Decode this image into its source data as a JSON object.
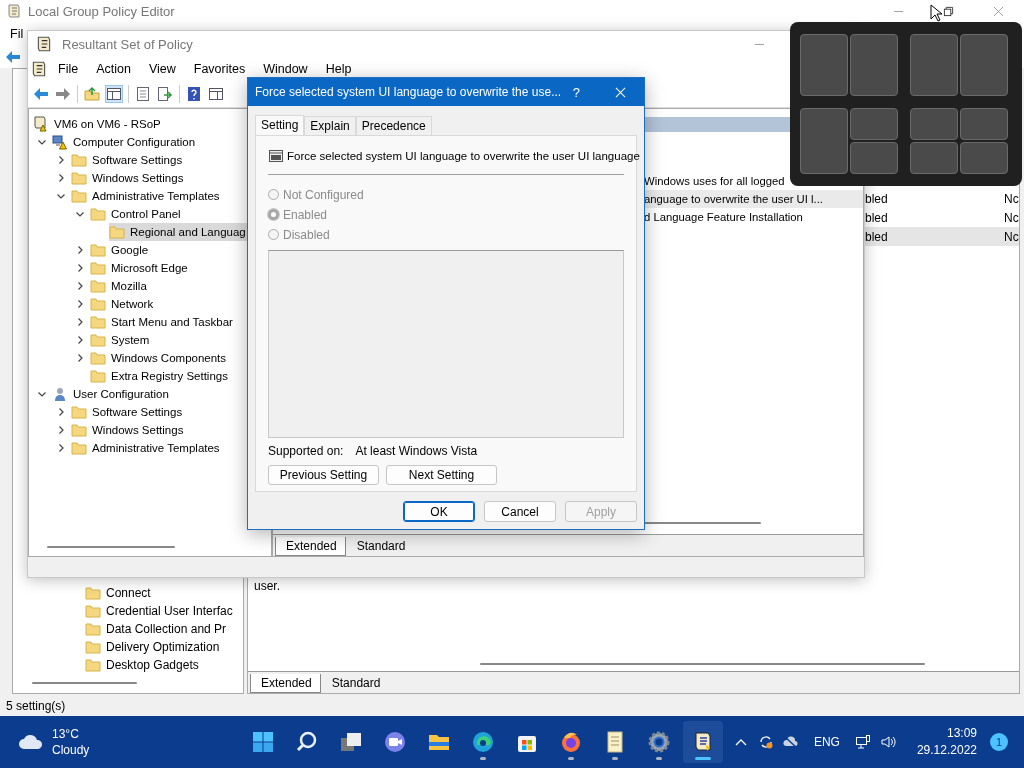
{
  "background_window": {
    "title": "Local Group Policy Editor",
    "menu": [
      "Fil"
    ],
    "tree_items": [
      "Connect",
      "Credential User Interfac",
      "Data Collection and Pr",
      "Delivery Optimization",
      "Desktop Gadgets"
    ],
    "list_rows": [
      {
        "column_2": "bled",
        "column_3": "Nc",
        "selected": false
      },
      {
        "column_2": "bled",
        "column_3": "Nc",
        "selected": false
      },
      {
        "column_2": "bled",
        "column_3": "Nc",
        "selected": true
      }
    ],
    "description": "user.",
    "view_tabs": [
      {
        "label": "Extended",
        "selected": true
      },
      {
        "label": "Standard",
        "selected": false
      }
    ],
    "status_bar": "5 setting(s)"
  },
  "rsop_window": {
    "title": "Resultant Set of Policy",
    "menu": [
      "File",
      "Action",
      "View",
      "Favorites",
      "Window",
      "Help"
    ],
    "tree": [
      {
        "label": "VM6 on VM6 - RSoP",
        "kind": "rsop",
        "selected": false,
        "children": [
          {
            "label": "Computer Configuration",
            "kind": "computer",
            "expanded": true,
            "selected": false,
            "children": [
              {
                "label": "Software Settings",
                "kind": "folder",
                "expanded": false,
                "selected": false
              },
              {
                "label": "Windows Settings",
                "kind": "folder",
                "expanded": false,
                "selected": false
              },
              {
                "label": "Administrative Templates",
                "kind": "folder",
                "expanded": true,
                "selected": false,
                "children": [
                  {
                    "label": "Control Panel",
                    "kind": "folder",
                    "expanded": true,
                    "selected": false,
                    "children": [
                      {
                        "label": "Regional and Languag",
                        "kind": "folder",
                        "selected": true
                      }
                    ]
                  },
                  {
                    "label": "Google",
                    "kind": "folder",
                    "expanded": false,
                    "selected": false
                  },
                  {
                    "label": "Microsoft Edge",
                    "kind": "folder",
                    "expanded": false,
                    "selected": false
                  },
                  {
                    "label": "Mozilla",
                    "kind": "folder",
                    "expanded": false,
                    "selected": false
                  },
                  {
                    "label": "Network",
                    "kind": "folder",
                    "expanded": false,
                    "selected": false
                  },
                  {
                    "label": "Start Menu and Taskbar",
                    "kind": "folder",
                    "expanded": false,
                    "selected": false
                  },
                  {
                    "label": "System",
                    "kind": "folder",
                    "expanded": false,
                    "selected": false
                  },
                  {
                    "label": "Windows Components",
                    "kind": "folder",
                    "expanded": false,
                    "selected": false
                  },
                  {
                    "label": "Extra Registry Settings",
                    "kind": "folder",
                    "selected": false
                  }
                ]
              }
            ]
          },
          {
            "label": "User Configuration",
            "kind": "user",
            "expanded": true,
            "selected": false,
            "children": [
              {
                "label": "Software Settings",
                "kind": "folder",
                "expanded": false,
                "selected": false
              },
              {
                "label": "Windows Settings",
                "kind": "folder",
                "expanded": false,
                "selected": false
              },
              {
                "label": "Administrative Templates",
                "kind": "folder",
                "expanded": false,
                "selected": false
              }
            ]
          }
        ]
      }
    ],
    "list_rows": [
      {
        "name": "Windows uses for all logged",
        "selected": false
      },
      {
        "name": "anguage to overwrite the user UI l...",
        "selected": true
      },
      {
        "name": "d Language Feature Installation",
        "selected": false
      }
    ],
    "view_tabs": [
      {
        "label": "Extended",
        "selected": true
      },
      {
        "label": "Standard",
        "selected": false
      }
    ]
  },
  "dialog": {
    "title": "Force selected system UI language to overwrite the use...",
    "help": "?",
    "tabs": [
      {
        "label": "Setting",
        "selected": true
      },
      {
        "label": "Explain",
        "selected": false
      },
      {
        "label": "Precedence",
        "selected": false
      }
    ],
    "setting_name": "Force selected system UI language to overwrite the user UI language",
    "options_disabled": true,
    "options": [
      {
        "label": "Not Configured",
        "selected": false
      },
      {
        "label": "Enabled",
        "selected": true
      },
      {
        "label": "Disabled",
        "selected": false
      }
    ],
    "supported_on_label": "Supported on:",
    "supported_on": "At least Windows Vista",
    "nav_buttons": [
      "Previous Setting",
      "Next Setting"
    ],
    "buttons": [
      {
        "label": "OK",
        "default": true,
        "disabled": false
      },
      {
        "label": "Cancel",
        "default": false,
        "disabled": false
      },
      {
        "label": "Apply",
        "default": false,
        "disabled": true
      }
    ]
  },
  "taskbar": {
    "weather": {
      "temperature": "13°C",
      "condition": "Cloudy"
    },
    "apps": [
      {
        "kind": "start",
        "running": false,
        "active": false
      },
      {
        "kind": "search",
        "running": false,
        "active": false
      },
      {
        "kind": "task-view",
        "running": false,
        "active": false
      },
      {
        "kind": "chat",
        "running": false,
        "active": false
      },
      {
        "kind": "explorer",
        "running": false,
        "active": false
      },
      {
        "kind": "edge",
        "running": true,
        "active": false
      },
      {
        "kind": "store",
        "running": false,
        "active": false
      },
      {
        "kind": "firefox",
        "running": true,
        "active": false
      },
      {
        "kind": "notepad",
        "running": true,
        "active": false
      },
      {
        "kind": "settings",
        "running": true,
        "active": false
      },
      {
        "kind": "policy",
        "running": true,
        "active": true
      }
    ],
    "language": "ENG",
    "time": "13:09",
    "date": "29.12.2022",
    "notifications": "1"
  }
}
